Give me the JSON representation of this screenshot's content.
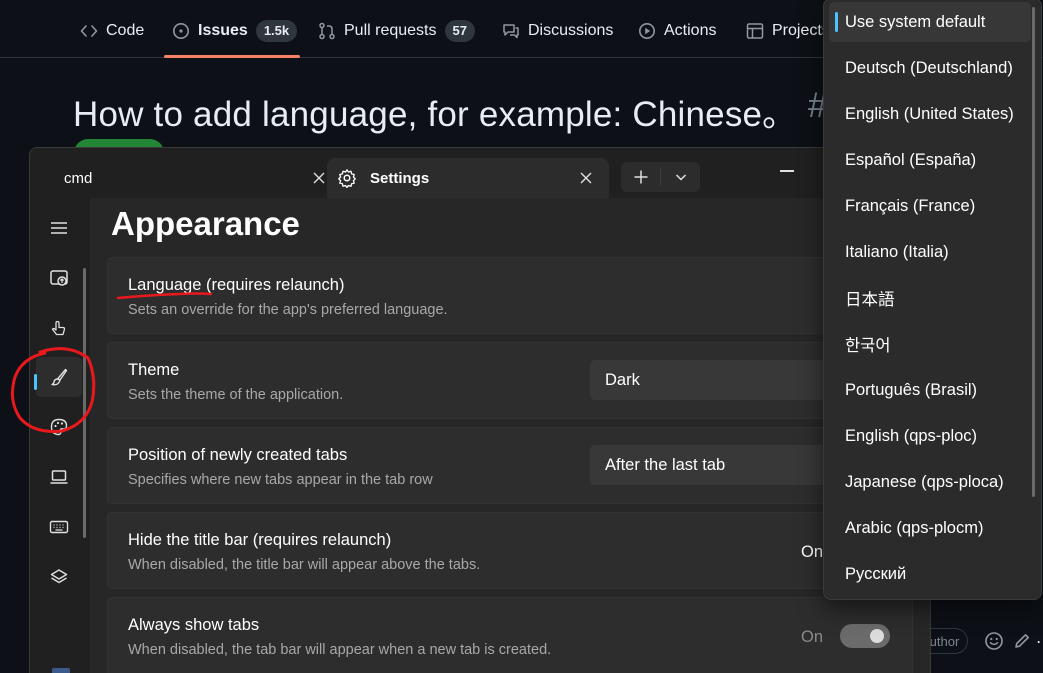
{
  "github": {
    "nav": {
      "code": "Code",
      "issues": "Issues",
      "issues_count": "1.5k",
      "pulls": "Pull requests",
      "pulls_count": "57",
      "discussions": "Discussions",
      "actions": "Actions",
      "projects": "Projects"
    },
    "issue_title": "How to add language, for example: Chinese。",
    "issue_hash": "#",
    "author_badge": "Author"
  },
  "terminal": {
    "tabs": [
      {
        "label": "cmd"
      },
      {
        "label": "Settings"
      }
    ],
    "page_title": "Appearance",
    "settings": {
      "language": {
        "title": "Language (requires relaunch)",
        "desc": "Sets an override for the app's preferred language."
      },
      "theme": {
        "title": "Theme",
        "desc": "Sets the theme of the application.",
        "value": "Dark"
      },
      "tab_position": {
        "title": "Position of newly created tabs",
        "desc": "Specifies where new tabs appear in the tab row",
        "value": "After the last tab"
      },
      "hide_title_bar": {
        "title": "Hide the title bar (requires relaunch)",
        "desc": "When disabled, the title bar will appear above the tabs.",
        "state": "On"
      },
      "always_show_tabs": {
        "title": "Always show tabs",
        "desc": "When disabled, the tab bar will appear when a new tab is created.",
        "state": "On"
      }
    },
    "nav_icons": [
      "hamburger-icon",
      "startup-icon",
      "interaction-icon",
      "appearance-icon",
      "color-schemes-icon",
      "rendering-icon",
      "actions-icon",
      "profiles-icon"
    ]
  },
  "language_dropdown": {
    "selected_index": 0,
    "options": [
      "Use system default",
      "Deutsch (Deutschland)",
      "English (United States)",
      "Español (España)",
      "Français (France)",
      "Italiano (Italia)",
      "日本語",
      "한국어",
      "Português (Brasil)",
      "English (qps-ploc)",
      "Japanese (qps-ploca)",
      "Arabic (qps-plocm)",
      "Русский"
    ]
  },
  "colors": {
    "accent": "#4cc2ff",
    "annotation": "#e8191c",
    "github_underline": "#f78166"
  }
}
